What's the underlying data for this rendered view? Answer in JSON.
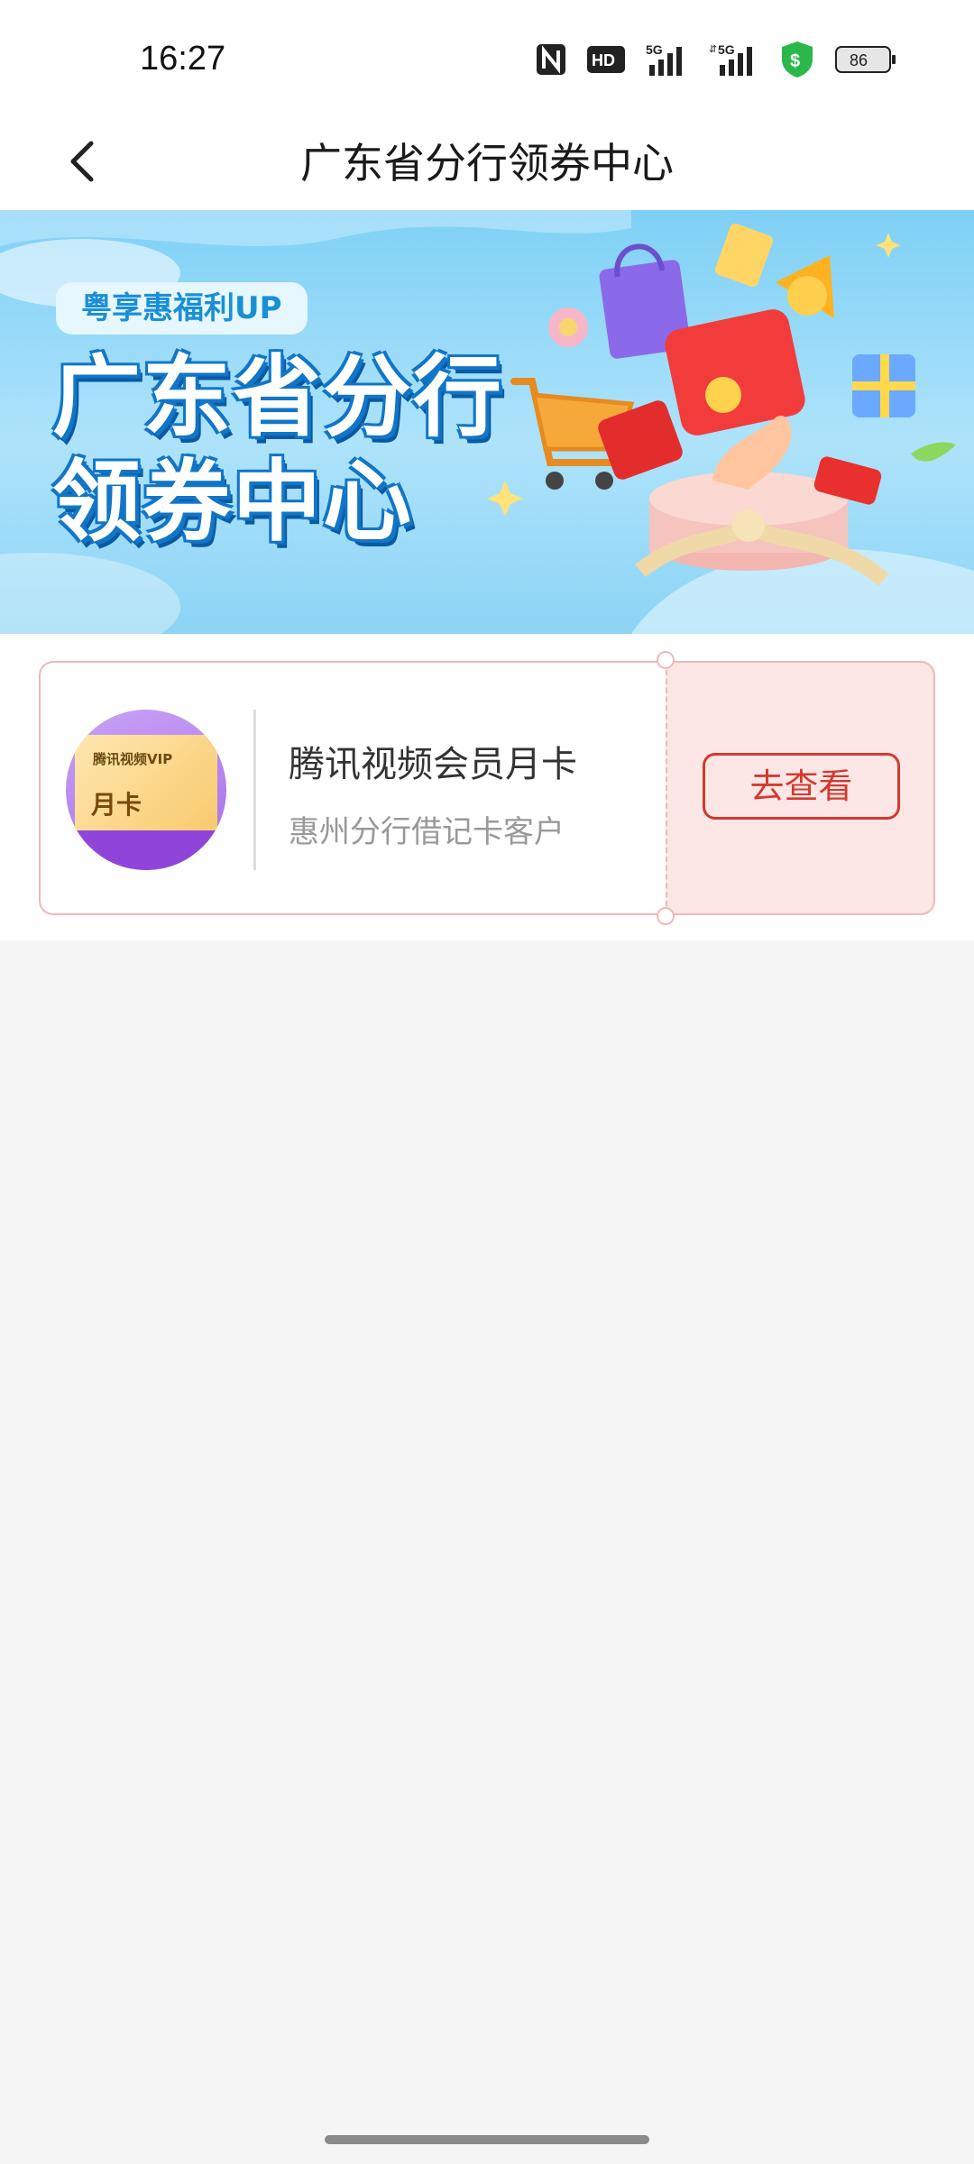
{
  "status_bar": {
    "time": "16:27",
    "battery": "86",
    "icons": [
      "nfc-icon",
      "hd-icon",
      "signal-5g-icon",
      "signal-5g-icon",
      "security-shield-icon",
      "battery-icon"
    ]
  },
  "header": {
    "title": "广东省分行领券中心",
    "back_icon": "chevron-left-icon"
  },
  "banner": {
    "tag": "粤享惠福利UP",
    "title_line1": "广东省分行",
    "title_line2": "领券中心"
  },
  "coupons": [
    {
      "name": "腾讯视频会员月卡",
      "description": "惠州分行借记卡客户",
      "action_label": "去查看",
      "thumb_brand": "腾讯视频VIP",
      "thumb_text": "月卡"
    }
  ],
  "colors": {
    "accent": "#d33a2f",
    "coupon_side_bg": "#fce6e6",
    "page_bg": "#f5f5f5"
  }
}
